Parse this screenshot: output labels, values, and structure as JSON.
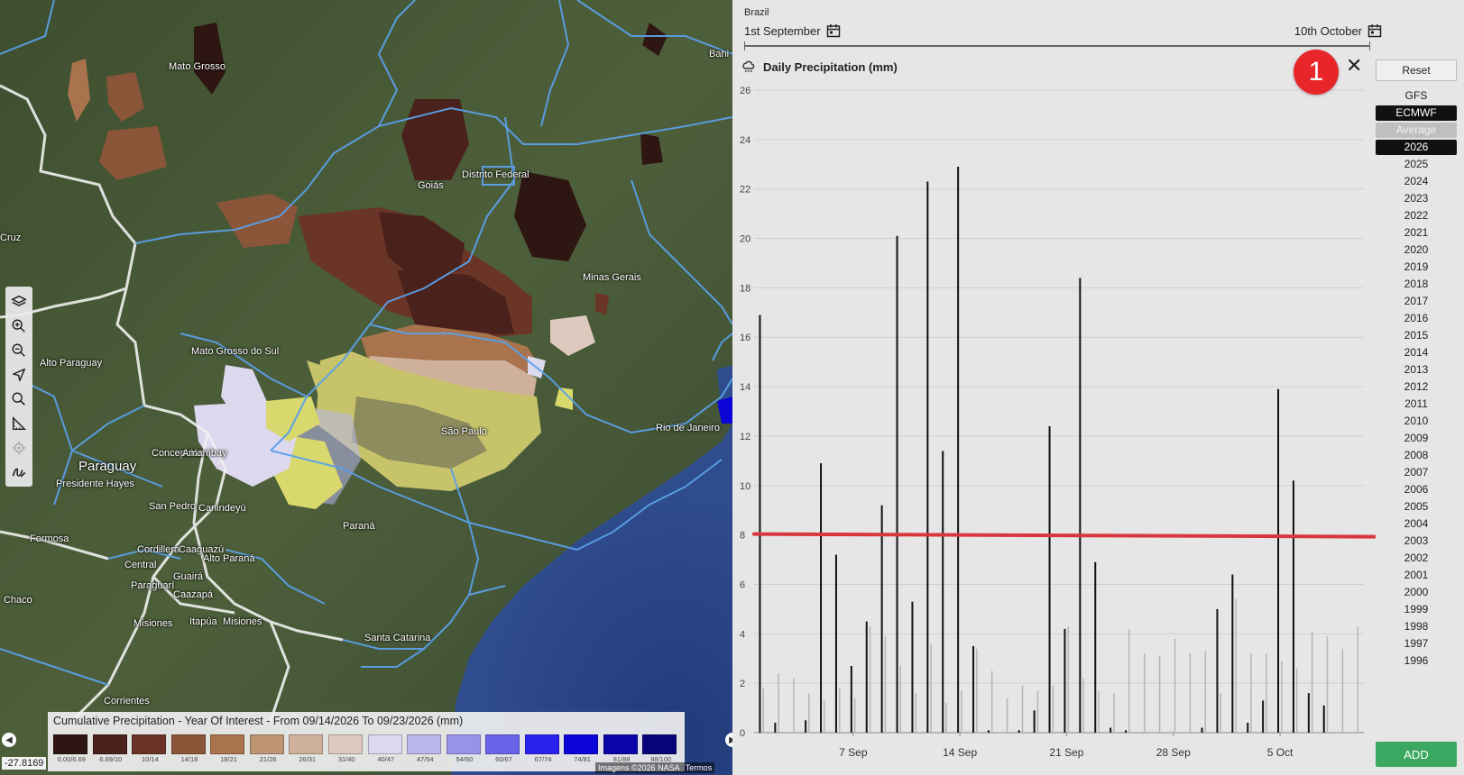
{
  "map": {
    "labels": [
      {
        "text": "Mato Grosso",
        "big": false
      },
      {
        "text": "Distrito Federal",
        "big": false
      },
      {
        "text": "Goiás",
        "big": false
      },
      {
        "text": "Minas Gerais",
        "big": false
      },
      {
        "text": "Mato Grosso do Sul",
        "big": false
      },
      {
        "text": "Alto Paraguay",
        "big": false
      },
      {
        "text": "Paraguay",
        "big": true
      },
      {
        "text": "Concepción",
        "big": false
      },
      {
        "text": "Amambay",
        "big": false
      },
      {
        "text": "Presidente Hayes",
        "big": false
      },
      {
        "text": "San Pedro",
        "big": false
      },
      {
        "text": "Canindeyú",
        "big": false
      },
      {
        "text": "São Paulo",
        "big": false
      },
      {
        "text": "Rio de Janeiro",
        "big": false
      },
      {
        "text": "Paraná",
        "big": false
      },
      {
        "text": "Formosa",
        "big": false
      },
      {
        "text": "Cordillera",
        "big": false
      },
      {
        "text": "Caaguazú",
        "big": false
      },
      {
        "text": "Central",
        "big": false
      },
      {
        "text": "Alto Paraná",
        "big": false
      },
      {
        "text": "Guairá",
        "big": false
      },
      {
        "text": "Paraguarí",
        "big": false
      },
      {
        "text": "Caazapá",
        "big": false
      },
      {
        "text": "Chaco",
        "big": false
      },
      {
        "text": "Misiones",
        "big": false
      },
      {
        "text": "Itapúa",
        "big": false
      },
      {
        "text": "Misiones",
        "big": false
      },
      {
        "text": "Santa Catarina",
        "big": false
      },
      {
        "text": "Corrientes",
        "big": false
      },
      {
        "text": "Cruz",
        "big": false
      },
      {
        "text": "Bahi",
        "big": false
      }
    ],
    "tools": [
      "layers-icon",
      "zoom-in-icon",
      "zoom-out-icon",
      "navigate-icon",
      "search-icon",
      "measure-icon",
      "locate-icon",
      "draw-icon"
    ],
    "coordinate": "-27.8169",
    "attribution": [
      "Imagens ©2026 NASA",
      "Termos"
    ]
  },
  "legend": {
    "title": "Cumulative Precipitation - Year Of Interest - From 09/14/2026 To 09/23/2026 (mm)",
    "items": [
      {
        "label": "0.00/6.69",
        "color": "#2e1613"
      },
      {
        "label": "6.69/10",
        "color": "#4a211b"
      },
      {
        "label": "10/14",
        "color": "#6a3526"
      },
      {
        "label": "14/18",
        "color": "#8a5538"
      },
      {
        "label": "18/21",
        "color": "#a8734d"
      },
      {
        "label": "21/26",
        "color": "#bd9474"
      },
      {
        "label": "26/31",
        "color": "#cfb09b"
      },
      {
        "label": "31/40",
        "color": "#ddc9bd"
      },
      {
        "label": "40/47",
        "color": "#dcd8ee"
      },
      {
        "label": "47/54",
        "color": "#b9b6ec"
      },
      {
        "label": "54/60",
        "color": "#9893ea"
      },
      {
        "label": "60/67",
        "color": "#6a63e8"
      },
      {
        "label": "67/74",
        "color": "#2a22ef"
      },
      {
        "label": "74/81",
        "color": "#0d05d8"
      },
      {
        "label": "81/88",
        "color": "#0a05a8"
      },
      {
        "label": "88/100",
        "color": "#07047a"
      }
    ]
  },
  "panel": {
    "region": "Brazil",
    "start_date": "1st September",
    "end_date": "10th October",
    "badge": "1",
    "close": "✕",
    "reset_label": "Reset",
    "add_label": "ADD",
    "models": [
      {
        "label": "GFS",
        "state": "normal"
      },
      {
        "label": "ECMWF",
        "state": "selected"
      },
      {
        "label": "Average",
        "state": "muted"
      }
    ],
    "years": [
      "2026",
      "2025",
      "2024",
      "2023",
      "2022",
      "2021",
      "2020",
      "2019",
      "2018",
      "2017",
      "2016",
      "2015",
      "2014",
      "2013",
      "2012",
      "2011",
      "2010",
      "2009",
      "2008",
      "2007",
      "2006",
      "2005",
      "2004",
      "2003",
      "2002",
      "2001",
      "2000",
      "1999",
      "1998",
      "1997",
      "1996"
    ],
    "selected_year": "2026"
  },
  "chart_data": {
    "type": "bar",
    "title": "Daily Precipitation (mm)",
    "xlabel": "",
    "ylabel": "",
    "ylim": [
      0,
      26
    ],
    "yticks": [
      0,
      2,
      4,
      6,
      8,
      10,
      12,
      14,
      16,
      18,
      20,
      22,
      24,
      26
    ],
    "xticks": [
      {
        "day": 7,
        "label": "7 Sep"
      },
      {
        "day": 14,
        "label": "14 Sep"
      },
      {
        "day": 21,
        "label": "21 Sep"
      },
      {
        "day": 28,
        "label": "28 Sep"
      },
      {
        "day": 35,
        "label": "5 Oct"
      }
    ],
    "grid": true,
    "threshold": {
      "value": 8.0,
      "color": "#d9363e"
    },
    "series": [
      {
        "color": "#111111",
        "x": [
          1,
          2,
          3,
          4,
          5,
          6,
          7,
          8,
          9,
          10,
          11,
          12,
          13,
          14,
          15,
          16,
          17,
          18,
          19,
          20,
          21,
          22,
          23,
          24,
          25,
          26,
          27,
          28,
          29,
          30,
          31,
          32,
          33,
          34,
          35,
          36,
          37,
          38,
          39,
          40
        ],
        "values": [
          16.9,
          0.4,
          0,
          0.5,
          10.9,
          7.2,
          2.7,
          4.5,
          9.2,
          20.1,
          5.3,
          22.3,
          11.4,
          22.9,
          3.5,
          0.1,
          0,
          0.1,
          0.9,
          12.4,
          4.2,
          18.4,
          6.9,
          0.2,
          0.1,
          0,
          0,
          0,
          0,
          0.2,
          5.0,
          6.4,
          0.4,
          1.3,
          13.9,
          10.2,
          1.6,
          1.1,
          0,
          0
        ]
      },
      {
        "color": "#b5b5b5",
        "x": [
          1,
          2,
          3,
          4,
          5,
          6,
          7,
          8,
          9,
          10,
          11,
          12,
          13,
          14,
          15,
          16,
          17,
          18,
          19,
          20,
          21,
          22,
          23,
          24,
          25,
          26,
          27,
          28,
          29,
          30,
          31,
          32,
          33,
          34,
          35,
          36,
          37,
          38,
          39,
          40
        ],
        "values": [
          1.8,
          2.4,
          2.2,
          1.6,
          1.3,
          1.8,
          1.4,
          4.3,
          3.9,
          2.7,
          1.6,
          3.6,
          1.2,
          1.7,
          3.4,
          2.5,
          1.4,
          1.9,
          1.7,
          1.9,
          4.3,
          2.2,
          1.7,
          1.6,
          4.2,
          3.2,
          3.1,
          3.8,
          3.2,
          3.3,
          1.6,
          5.4,
          3.2,
          3.2,
          2.9,
          2.6,
          4.1,
          3.9,
          3.4,
          4.3
        ]
      }
    ]
  }
}
